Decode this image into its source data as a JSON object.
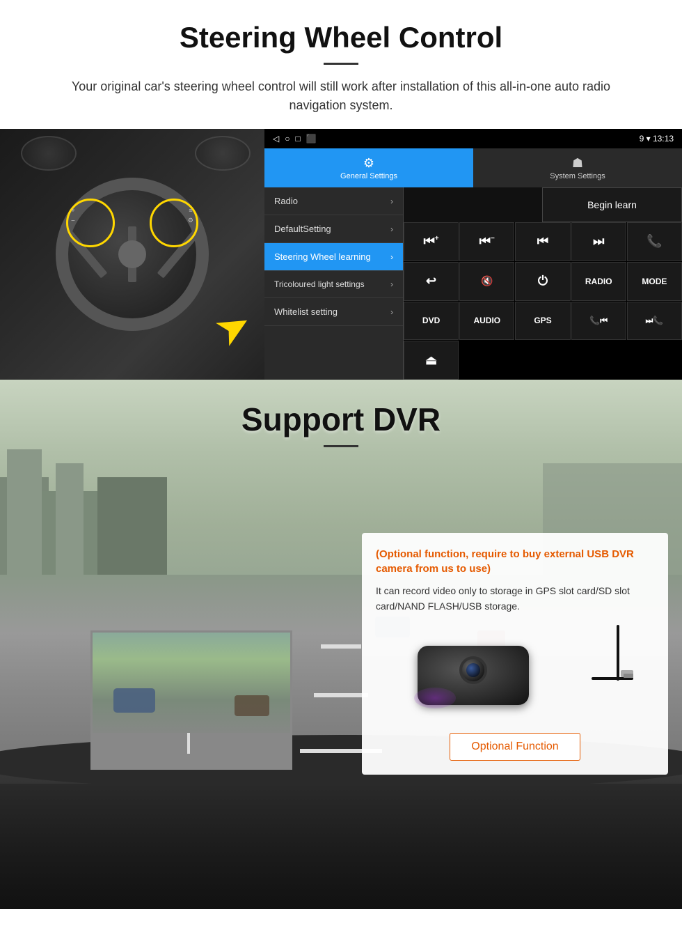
{
  "page": {
    "header": {
      "title": "Steering Wheel Control",
      "subtitle": "Your original car's steering wheel control will still work after installation of this all-in-one auto radio navigation system."
    },
    "android_ui": {
      "status_bar": {
        "left_icons": [
          "◁",
          "○",
          "□",
          "⬛"
        ],
        "right_info": "9 ▾ 13:13"
      },
      "tabs": [
        {
          "label": "General Settings",
          "active": true,
          "icon": "⚙"
        },
        {
          "label": "System Settings",
          "active": false,
          "icon": "☗"
        }
      ],
      "menu_items": [
        {
          "label": "Radio",
          "active": false
        },
        {
          "label": "DefaultSetting",
          "active": false
        },
        {
          "label": "Steering Wheel learning",
          "active": true
        },
        {
          "label": "Tricoloured light settings",
          "active": false
        },
        {
          "label": "Whitelist setting",
          "active": false
        }
      ],
      "begin_learn_label": "Begin learn",
      "control_buttons": [
        "⏮+",
        "⏮-",
        "⏮",
        "⏭",
        "📞",
        "↩",
        "🔇",
        "⏻",
        "RADIO",
        "MODE",
        "DVD",
        "AUDIO",
        "GPS",
        "📞⏮",
        "⏭📞",
        "⏏"
      ]
    },
    "dvr_section": {
      "title": "Support DVR",
      "info_box": {
        "optional_text": "(Optional function, require to buy external USB DVR camera from us to use)",
        "description": "It can record video only to storage in GPS slot card/SD slot card/NAND FLASH/USB storage."
      },
      "optional_button_label": "Optional Function"
    }
  }
}
